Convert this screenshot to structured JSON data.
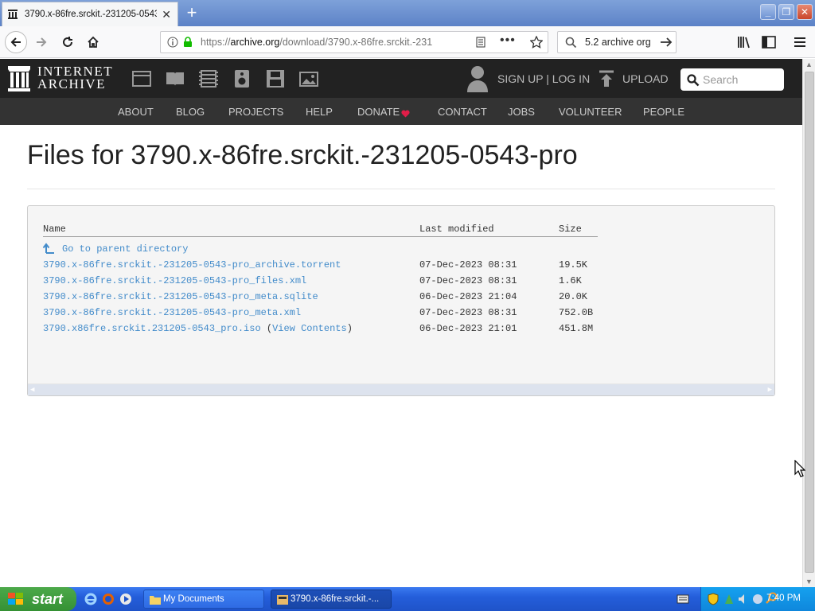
{
  "browser": {
    "tab_title": "3790.x-86fre.srckit.-231205-0543",
    "url_prefix": "https://",
    "url_host": "archive.org",
    "url_path": "/download/3790.x-86fre.srckit.-231",
    "search_text": "5.2 archive org",
    "icons": [
      "back-icon",
      "forward-icon",
      "reload-icon",
      "home-icon",
      "info-icon",
      "lock-icon",
      "reader-icon",
      "more-icon",
      "star-icon",
      "search-icon",
      "library-icon",
      "sidebar-icon",
      "menu-icon"
    ]
  },
  "ia_header": {
    "logo_line1": "INTERNET",
    "logo_line2": "ARCHIVE",
    "signin": "SIGN UP | LOG IN",
    "upload": "UPLOAD",
    "search_placeholder": "Search",
    "nav": [
      "ABOUT",
      "BLOG",
      "PROJECTS",
      "HELP",
      "DONATE",
      "CONTACT",
      "JOBS",
      "VOLUNTEER",
      "PEOPLE"
    ],
    "donate_heart_color": "#e11d48"
  },
  "page": {
    "title": "Files for 3790.x-86fre.srckit.-231205-0543-pro",
    "columns": {
      "name": "Name",
      "modified": "Last modified",
      "size": "Size"
    },
    "parent_link": "Go to parent directory",
    "files": [
      {
        "name": "3790.x-86fre.srckit.-231205-0543-pro_archive.torrent",
        "extra": "",
        "modified": "07-Dec-2023 08:31",
        "size": "19.5K"
      },
      {
        "name": "3790.x-86fre.srckit.-231205-0543-pro_files.xml",
        "extra": "",
        "modified": "07-Dec-2023 08:31",
        "size": "1.6K"
      },
      {
        "name": "3790.x-86fre.srckit.-231205-0543-pro_meta.sqlite",
        "extra": "",
        "modified": "06-Dec-2023 21:04",
        "size": "20.0K"
      },
      {
        "name": "3790.x-86fre.srckit.-231205-0543-pro_meta.xml",
        "extra": "",
        "modified": "07-Dec-2023 08:31",
        "size": "752.0B"
      },
      {
        "name": "3790.x86fre.srckit.231205-0543_pro.iso",
        "extra": "View Contents",
        "modified": "06-Dec-2023 21:01",
        "size": "451.8M"
      }
    ]
  },
  "taskbar": {
    "start": "start",
    "tasks": [
      "My Documents",
      "3790.x-86fre.srckit.-..."
    ],
    "clock": "7:40 PM"
  }
}
